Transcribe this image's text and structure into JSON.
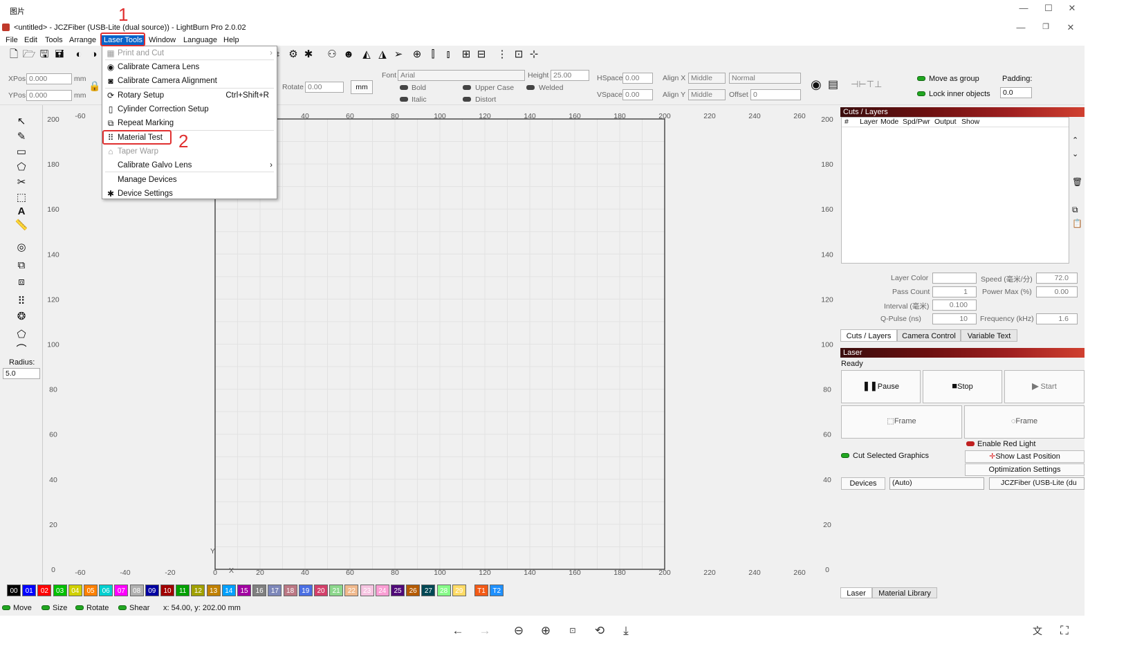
{
  "photo_viewer": {
    "title": "图片",
    "controls": {
      "minimize": "—",
      "maximize": "☐",
      "close": "✕"
    },
    "bottom_icons": [
      "back-arrow-icon",
      "forward-arrow-icon",
      "zoom-out-icon",
      "zoom-in-icon",
      "actual-size-icon",
      "rotate-icon",
      "download-icon",
      "translate-icon",
      "ocr-icon"
    ]
  },
  "app": {
    "title": "<untitled> - JCZFiber (USB-Lite (dual source)) - LightBurn Pro 2.0.02",
    "menus": [
      "File",
      "Edit",
      "Tools",
      "Arrange",
      "Laser Tools",
      "Window",
      "Language",
      "Help"
    ],
    "active_menu": "Laser Tools"
  },
  "props": {
    "xpos_label": "XPos",
    "xpos": "0.000",
    "ypos_label": "YPos",
    "ypos": "0.000",
    "unit1": "mm",
    "unit2": "mm",
    "rotate_label": "Rotate",
    "rotate": "0.00",
    "mm_button": "mm",
    "font_label": "Font",
    "font": "Arial",
    "height_label": "Height",
    "height": "25.00",
    "hspace_label": "HSpace",
    "hspace": "0.00",
    "vspace_label": "VSpace",
    "vspace": "0.00",
    "alignx_label": "Align X",
    "alignx": "Middle",
    "aligny_label": "Align Y",
    "aligny": "Middle",
    "normal": "Normal",
    "offset_label": "Offset",
    "offset": "0",
    "bold": "Bold",
    "italic": "Italic",
    "upper_case": "Upper Case",
    "distort": "Distort",
    "welded": "Welded",
    "move_as_group": "Move as group",
    "lock_inner": "Lock inner objects",
    "padding_label": "Padding:",
    "padding": "0.0"
  },
  "left_tools": {
    "radius_label": "Radius:",
    "radius": "5.0"
  },
  "dropdown": {
    "items": [
      {
        "label": "Print and Cut",
        "icon": "print-cut-icon",
        "glyph": "▦",
        "disabled": true,
        "submenu": true
      },
      {
        "label": "Calibrate Camera Lens",
        "icon": "camera-icon",
        "glyph": "◉"
      },
      {
        "label": "Calibrate Camera Alignment",
        "icon": "camera-icon",
        "glyph": "◙"
      },
      {
        "label": "Rotary Setup",
        "icon": "rotary-icon",
        "glyph": "⟳",
        "shortcut": "Ctrl+Shift+R"
      },
      {
        "label": "Cylinder Correction Setup",
        "icon": "cylinder-icon",
        "glyph": "▯"
      },
      {
        "label": "Repeat Marking",
        "icon": "repeat-icon",
        "glyph": "⧉"
      },
      {
        "label": "Material Test",
        "icon": "grid-icon",
        "glyph": "⠿"
      },
      {
        "label": "Taper Warp",
        "icon": "taper-icon",
        "glyph": "⌂",
        "disabled": true
      },
      {
        "label": "Calibrate Galvo Lens",
        "icon": "",
        "glyph": "",
        "submenu": true
      },
      {
        "label": "Manage Devices",
        "icon": "",
        "glyph": ""
      },
      {
        "label": "Device Settings",
        "icon": "wrench-icon",
        "glyph": "✱"
      }
    ]
  },
  "annotations": {
    "one": "1",
    "two": "2"
  },
  "ruler": {
    "x_ticks": [
      "-60",
      "-40",
      "-20",
      "0",
      "20",
      "40",
      "60",
      "80",
      "100",
      "120",
      "140",
      "160",
      "180",
      "200",
      "220",
      "240",
      "260"
    ],
    "y_ticks": [
      "200",
      "180",
      "160",
      "140",
      "120",
      "100",
      "80",
      "60",
      "40",
      "20",
      "0"
    ],
    "x_label": "X",
    "y_label": "Y"
  },
  "palette": [
    {
      "id": "00",
      "color": "#000000"
    },
    {
      "id": "01",
      "color": "#0000ff"
    },
    {
      "id": "02",
      "color": "#ff0000"
    },
    {
      "id": "03",
      "color": "#00c000"
    },
    {
      "id": "04",
      "color": "#d0d000"
    },
    {
      "id": "05",
      "color": "#ff8000"
    },
    {
      "id": "06",
      "color": "#00d0d0"
    },
    {
      "id": "07",
      "color": "#ff00ff"
    },
    {
      "id": "08",
      "color": "#b0b0b0"
    },
    {
      "id": "09",
      "color": "#0000a0"
    },
    {
      "id": "10",
      "color": "#a00000"
    },
    {
      "id": "11",
      "color": "#00a000"
    },
    {
      "id": "12",
      "color": "#a0a000"
    },
    {
      "id": "13",
      "color": "#c08000"
    },
    {
      "id": "14",
      "color": "#00a0ff"
    },
    {
      "id": "15",
      "color": "#a000a0"
    },
    {
      "id": "16",
      "color": "#808080"
    },
    {
      "id": "17",
      "color": "#7d87b9"
    },
    {
      "id": "18",
      "color": "#bb7784"
    },
    {
      "id": "19",
      "color": "#4a6fe3"
    },
    {
      "id": "20",
      "color": "#d33f6a"
    },
    {
      "id": "21",
      "color": "#8cd78c"
    },
    {
      "id": "22",
      "color": "#f0b98d"
    },
    {
      "id": "23",
      "color": "#f6c4e1"
    },
    {
      "id": "24",
      "color": "#fa9ed4"
    },
    {
      "id": "25",
      "color": "#500a78"
    },
    {
      "id": "26",
      "color": "#b45a00"
    },
    {
      "id": "27",
      "color": "#004754"
    },
    {
      "id": "28",
      "color": "#86fa88"
    },
    {
      "id": "29",
      "color": "#ffdb66"
    },
    {
      "id": "T1",
      "color": "#f35a16"
    },
    {
      "id": "T2",
      "color": "#1e90ff"
    }
  ],
  "status": {
    "move": "Move",
    "size": "Size",
    "rotate": "Rotate",
    "shear": "Shear",
    "coords": "x: 54.00, y: 202.00 mm"
  },
  "cuts": {
    "header": "Cuts / Layers",
    "columns": [
      "#",
      "Layer",
      "Mode",
      "Spd/Pwr",
      "Output",
      "Show"
    ],
    "layer_color_label": "Layer Color",
    "speed_label": "Speed (毫米/分)",
    "speed": "72.0",
    "pass_count_label": "Pass Count",
    "pass_count": "1",
    "power_max_label": "Power Max (%)",
    "power_max": "0.00",
    "interval_label": "Interval (毫米)",
    "interval": "0.100",
    "qpulse_label": "Q-Pulse (ns)",
    "qpulse": "10",
    "frequency_label": "Frequency (kHz)",
    "frequency": "1.6",
    "tabs": [
      "Cuts / Layers",
      "Camera Control",
      "Variable Text"
    ]
  },
  "laser": {
    "header": "Laser",
    "status": "Ready",
    "pause": "Pause",
    "stop": "Stop",
    "start": "Start",
    "frame1": "Frame",
    "frame2": "Frame",
    "enable_red_light": "Enable Red Light",
    "cut_selected": "Cut Selected Graphics",
    "show_last_position": "Show Last Position",
    "optimization": "Optimization Settings",
    "devices": "Devices",
    "auto": "(Auto)",
    "device": "JCZFiber (USB-Lite (du",
    "tabs": [
      "Laser",
      "Material Library"
    ]
  }
}
